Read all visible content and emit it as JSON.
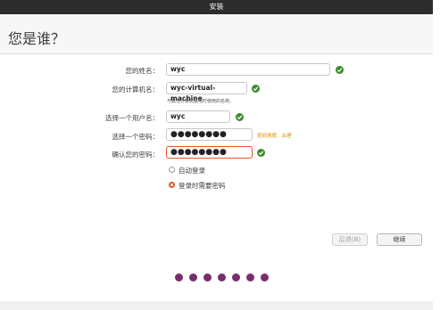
{
  "window": {
    "title": "安装"
  },
  "page": {
    "title": "您是谁？"
  },
  "form": {
    "name_label": "您的姓名：",
    "name_value": "wyc",
    "computer_label": "您的计算机名：",
    "computer_value": "wyc-virtual-machine",
    "computer_hint": "与其他计算机联络时使用的名称。",
    "username_label": "选择一个用户名：",
    "username_value": "wyc",
    "password_label": "选择一个密码：",
    "password_value": "●●●●●●●●",
    "password_strength": "密码强度：合理",
    "confirm_label": "确认您的密码：",
    "confirm_value": "●●●●●●●●"
  },
  "login_options": {
    "auto_login": "自动登录",
    "require_password": "登录时需要密码",
    "selected": "require_password"
  },
  "buttons": {
    "back": "后退(B)",
    "continue": "继续"
  },
  "progress": {
    "total_steps": 7
  },
  "colors": {
    "accent": "#e95420",
    "ok": "#3a8d2b",
    "progress": "#7b2d6f",
    "titlebar": "#2c2c2c"
  }
}
